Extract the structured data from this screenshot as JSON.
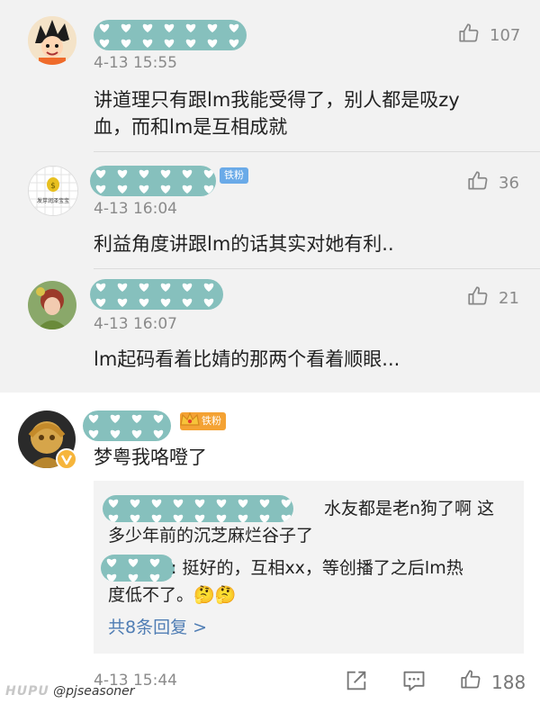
{
  "comments": [
    {
      "time": "4-13 15:55",
      "likes": "107",
      "text_lines": [
        "讲道理只有跟lm我能受得了，别人都是吸zy",
        "血，而和lm是互相成就"
      ]
    },
    {
      "time": "4-13 16:04",
      "likes": "36",
      "badge": "铁粉",
      "avatar_caption": "发芽润泽宝宝",
      "text_lines": [
        "利益角度讲跟lm的话其实对她有利.."
      ]
    },
    {
      "time": "4-13 16:07",
      "likes": "21",
      "text_lines": [
        "lm起码看着比婧的那两个看着顺眼..."
      ]
    }
  ],
  "main_comment": {
    "badge": "铁粉",
    "text": "梦粤我咯噔了",
    "replies": [
      {
        "lines": [
          "水友都是老n狗了啊 这",
          "多少年前的沉芝麻烂谷子了"
        ]
      },
      {
        "lines": [
          ": 挺好的，互相xx，等创播了之后lm热",
          "度低不了。🤔🤔"
        ]
      }
    ],
    "more_replies": "共8条回复 >",
    "time": "4-13 15:44",
    "likes": "188"
  },
  "watermark": {
    "site": "HUPU",
    "user": "@pjseasoner"
  },
  "icons": {
    "like": "thumbs-up-icon",
    "share": "share-icon",
    "comment": "comment-icon",
    "verified": "verified-badge-icon",
    "crown": "crown-icon"
  },
  "colors": {
    "mask": "#86c0bd",
    "badge_blue": "#6aaae8",
    "badge_gold": "#f4a233",
    "link_blue": "#4f7db4",
    "verified": "#f6b53b"
  }
}
